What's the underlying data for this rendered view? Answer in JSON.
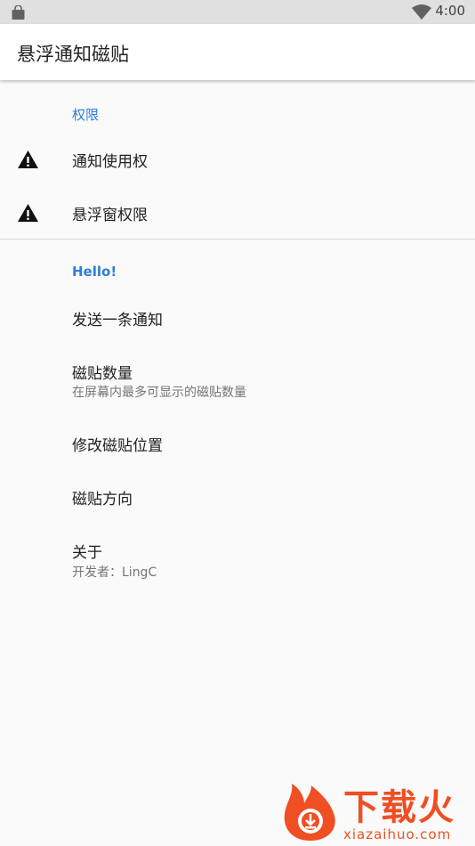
{
  "status_bar": {
    "time": "4:00"
  },
  "app_bar": {
    "title": "悬浮通知磁贴"
  },
  "permissions": {
    "header": "权限",
    "items": [
      {
        "title": "通知使用权",
        "icon": "warning-icon"
      },
      {
        "title": "悬浮窗权限",
        "icon": "warning-icon"
      }
    ]
  },
  "hello": {
    "header": "Hello!",
    "items": [
      {
        "title": "发送一条通知"
      },
      {
        "title": "磁贴数量",
        "subtitle": "在屏幕内最多可显示的磁贴数量"
      },
      {
        "title": "修改磁贴位置"
      },
      {
        "title": "磁贴方向"
      },
      {
        "title": "关于",
        "subtitle": "开发者：LingC"
      }
    ]
  },
  "watermark": {
    "text": "下载火",
    "url": "xiazaihuo.com"
  },
  "colors": {
    "accent": "#2f7ed3",
    "status_bar": "#e0e0e0",
    "watermark": "#f04e23"
  }
}
